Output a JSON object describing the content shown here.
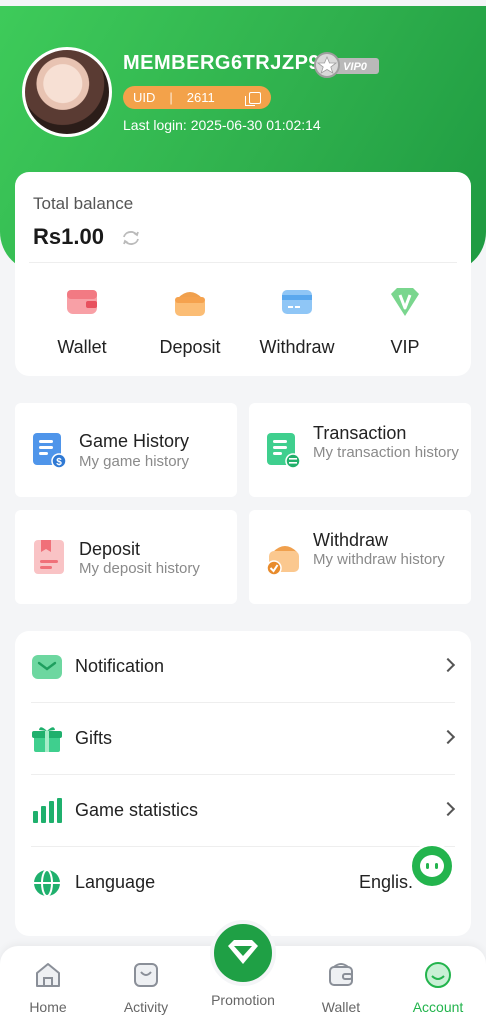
{
  "profile": {
    "username": "MEMBERG6TRJZP9",
    "vip_label": "VIP0",
    "uid_label": "UID",
    "uid_value": "2611",
    "last_login": "Last login: 2025-06-30 01:02:14"
  },
  "balance": {
    "label": "Total balance",
    "value": "Rs1.00"
  },
  "quick_actions": [
    {
      "label": "Wallet",
      "icon": "wallet-icon"
    },
    {
      "label": "Deposit",
      "icon": "deposit-icon"
    },
    {
      "label": "Withdraw",
      "icon": "withdraw-icon"
    },
    {
      "label": "VIP",
      "icon": "vip-icon"
    }
  ],
  "history_tiles": [
    {
      "title": "Game History",
      "subtitle": "My game history"
    },
    {
      "title": "Transaction",
      "subtitle": "My transaction history"
    },
    {
      "title": "Deposit",
      "subtitle": "My deposit history"
    },
    {
      "title": "Withdraw",
      "subtitle": "My withdraw history"
    }
  ],
  "menu": [
    {
      "label": "Notification"
    },
    {
      "label": "Gifts"
    },
    {
      "label": "Game statistics"
    },
    {
      "label": "Language",
      "value": "Englis."
    }
  ],
  "tabs": [
    {
      "label": "Home"
    },
    {
      "label": "Activity"
    },
    {
      "label": "Promotion"
    },
    {
      "label": "Wallet"
    },
    {
      "label": "Account"
    }
  ],
  "colors": {
    "brand_green": "#23b44d",
    "uid_orange": "#f3a24a"
  }
}
